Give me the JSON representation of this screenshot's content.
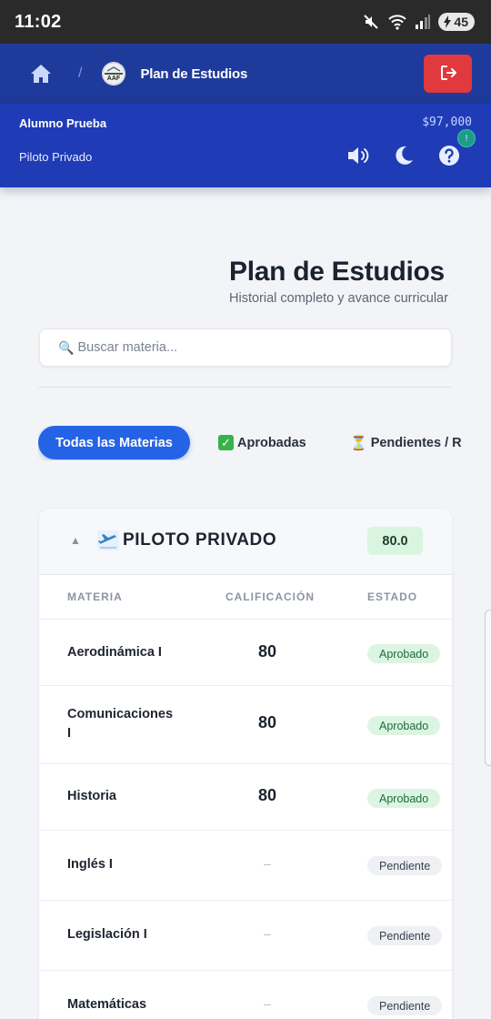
{
  "status_bar": {
    "time": "11:02",
    "battery_level": "45",
    "icons": [
      "mute-icon",
      "wifi-icon",
      "signal-icon",
      "battery-charging-icon"
    ]
  },
  "header": {
    "title": "Plan de Estudios",
    "home_icon": "home-icon",
    "breadcrumb_separator": "/",
    "logo_text": "AAF",
    "logout_icon": "logout-icon"
  },
  "user_bar": {
    "student_name": "Alumno Prueba",
    "balance": "$97,000",
    "program": "Piloto Privado",
    "help_badge": "!",
    "icons": [
      "sound-icon",
      "moon-icon",
      "help-icon"
    ]
  },
  "page": {
    "title": "Plan de Estudios",
    "subtitle": "Historial completo y avance curricular"
  },
  "search": {
    "icon": "🔍",
    "placeholder": "Buscar materia..."
  },
  "filters": {
    "all": "Todas las Materias",
    "approved_icon": "✓",
    "approved": "Aprobadas",
    "pending_icon": "⏳",
    "pending": "Pendientes / R"
  },
  "program_card": {
    "collapse_icon": "▲",
    "title": "PILOTO PRIVADO",
    "average": "80.0",
    "columns": {
      "subject": "MATERIA",
      "grade": "CALIFICACIÓN",
      "status": "ESTADO"
    },
    "rows": [
      {
        "subject": "Aerodinámica I",
        "grade": "80",
        "status": "Aprobado"
      },
      {
        "subject": "Comunicaciones I",
        "grade": "80",
        "status": "Aprobado"
      },
      {
        "subject": "Historia",
        "grade": "80",
        "status": "Aprobado"
      },
      {
        "subject": "Inglés I",
        "grade": "–",
        "status": "Pendiente"
      },
      {
        "subject": "Legislación I",
        "grade": "–",
        "status": "Pendiente"
      },
      {
        "subject": "Matemáticas",
        "grade": "–",
        "status": "Pendiente"
      }
    ]
  },
  "colors": {
    "header_bg": "#1e3a9a",
    "user_bar_bg": "#1f3cb6",
    "primary": "#2563e6",
    "danger": "#e0393e",
    "success_bg": "#dcf5e3"
  }
}
